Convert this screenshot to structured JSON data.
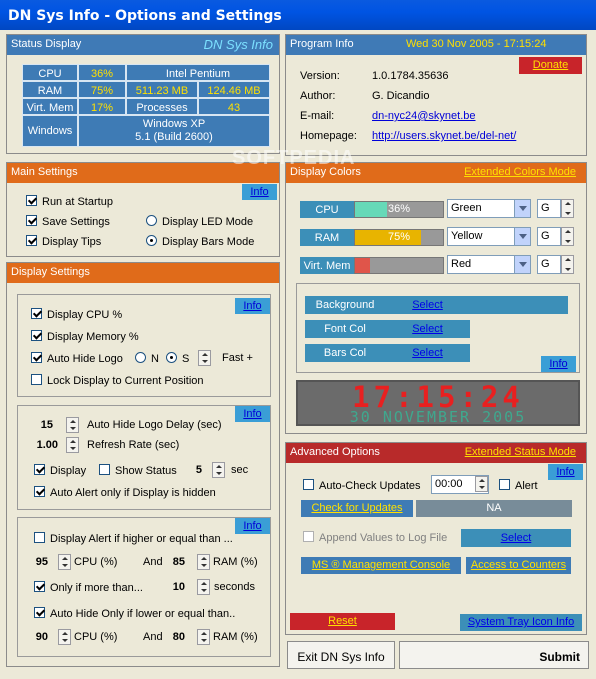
{
  "window": {
    "title": "DN Sys Info - Options and Settings"
  },
  "status": {
    "header": "Status Display",
    "logo": "DN Sys Info",
    "cpu_label": "CPU",
    "cpu_val": "36%",
    "cpu_name": "Intel Pentium",
    "ram_label": "RAM",
    "ram_pct": "75%",
    "ram_used": "511.23 MB",
    "ram_total": "124.46 MB",
    "vmem_label": "Virt. Mem",
    "vmem_pct": "17%",
    "proc_label": "Processes",
    "proc_val": "43",
    "win_label": "Windows",
    "win_name": "Windows XP",
    "win_build": "5.1 (Build 2600)"
  },
  "program": {
    "header": "Program Info",
    "datetime": "Wed 30 Nov 2005 - 17:15:24",
    "donate": "Donate",
    "version_label": "Version:",
    "version": "1.0.1784.35636",
    "author_label": "Author:",
    "author": "G. Dicandio",
    "email_label": "E-mail:",
    "email": "dn-nyc24@skynet.be",
    "home_label": "Homepage:",
    "home": "http://users.skynet.be/del-net/"
  },
  "main": {
    "header": "Main Settings",
    "info": "Info",
    "run": "Run at Startup",
    "save": "Save Settings",
    "tips": "Display Tips",
    "led": "Display LED Mode",
    "bars": "Display Bars Mode"
  },
  "display": {
    "header": "Display Settings",
    "info": "Info",
    "cpu": "Display CPU %",
    "mem": "Display Memory %",
    "autohide": "Auto Hide Logo",
    "n": "N",
    "s": "S",
    "fast": "Fast +",
    "lock": "Lock Display to Current Position"
  },
  "timing": {
    "info": "Info",
    "delay_val": "15",
    "delay": "Auto Hide Logo Delay (sec)",
    "rate_val": "1.00",
    "rate": "Refresh Rate (sec)",
    "display": "Display",
    "show": "Show Status",
    "sec_val": "5",
    "sec": "sec",
    "alert": "Auto Alert only if Display is hidden"
  },
  "alerts": {
    "info": "Info",
    "alert_higher": "Display Alert if higher or equal than ...",
    "v1": "95",
    "cpu1": "CPU (%)",
    "and1": "And",
    "v2": "85",
    "ram1": "RAM (%)",
    "more": "Only if more than...",
    "secs_val": "10",
    "seconds": "seconds",
    "autohide": "Auto Hide  Only if lower  or equal than..",
    "v3": "90",
    "cpu2": "CPU (%)",
    "and2": "And",
    "v4": "80",
    "ram2": "RAM (%)"
  },
  "colors": {
    "header": "Display Colors",
    "ext": "Extended Colors Mode",
    "rows": [
      {
        "label": "CPU",
        "pct": "36%",
        "pct_num": 0.36,
        "color": "Green",
        "g": "G",
        "fill": "#66d9b8"
      },
      {
        "label": "RAM",
        "pct": "75%",
        "pct_num": 0.75,
        "color": "Yellow",
        "g": "G",
        "fill": "#e8b400"
      },
      {
        "label": "Virt. Mem",
        "pct": "",
        "pct_num": 0.17,
        "color": "Red",
        "g": "G",
        "fill": "#e0554a"
      }
    ],
    "bg": "Background",
    "fontcol": "Font Col",
    "barscol": "Bars Col",
    "select": "Select",
    "info": "Info",
    "led_time": "17:15:24",
    "led_date": "30 NOVEMBER 2005"
  },
  "advanced": {
    "header": "Advanced Options",
    "ext": "Extended Status Mode",
    "info": "Info",
    "auto": "Auto-Check Updates",
    "time": "00:00",
    "alert": "Alert",
    "check": "Check for Updates",
    "na": "NA",
    "append": "Append Values to Log File",
    "select": "Select",
    "ms": "MS ® Management Console",
    "counters": "Access to Counters",
    "reset": "Reset",
    "tray": "System Tray Icon Info"
  },
  "footer": {
    "exit": "Exit DN Sys Info",
    "submit": "Submit"
  },
  "watermark": "SOFTPEDIA"
}
